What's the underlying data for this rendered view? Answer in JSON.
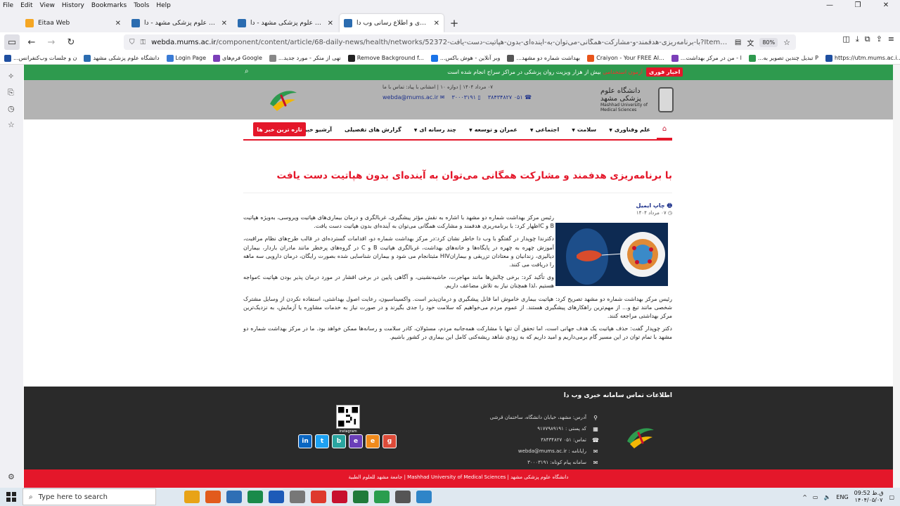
{
  "menubar": [
    "File",
    "Edit",
    "View",
    "History",
    "Bookmarks",
    "Tools",
    "Help"
  ],
  "window_controls": [
    "—",
    "❐",
    "✕"
  ],
  "tabs": [
    {
      "title": "Eitaa Web",
      "color": "#f5a623"
    },
    {
      "title": "دانشگاه علوم پزشکی مشهد - دا...",
      "color": "#2b6cb0"
    },
    {
      "title": "دانشگاه علوم پزشکی مشهد - دا...",
      "color": "#2b6cb0"
    },
    {
      "title": "پایگاه خبری و اطلاع رسانی وب دا",
      "color": "#2b6cb0"
    }
  ],
  "url": {
    "domain": "webda.mums.ac.ir",
    "prefix": "https://",
    "path": "/component/content/article/68-daily-news/health/networks/52372-با-برنامه‌ریزی-هدفمند-و-مشارکت-همگانی-می‌توان-به-آینده‌ای-بدون-هپاتیت-دست-یافت?Itemid=626"
  },
  "zoom": "80%",
  "bookmarks": [
    {
      "label": "...ن و جلسات وب‌کنفرانس",
      "color": "#1f4fa0"
    },
    {
      "label": "دانشگاه علوم پزشکی مشهد",
      "color": "#2b6cb0"
    },
    {
      "label": "Login Page",
      "color": "#3a7bd5"
    },
    {
      "label": "فرم‌های Google",
      "color": "#7b3fb8"
    },
    {
      "label": "...نهی از منکر - مورد جدید",
      "color": "#888888"
    },
    {
      "label": "Remove Background f...",
      "color": "#222222"
    },
    {
      "label": "...وبر آنلاین - هوش باکس",
      "color": "#1a73e8"
    },
    {
      "label": "...بهداشت شماره دو مشهد",
      "color": "#555555"
    },
    {
      "label": "Craiyon - Your FREE AI...",
      "color": "#e8541a"
    },
    {
      "label": "...ا - من در مرکز بهداشت",
      "color": "#7b3fb8"
    },
    {
      "label": "...تبدیل چندین تصویر به P",
      "color": "#2e9a4e"
    },
    {
      "label": "https://utm.mums.ac.i...",
      "color": "#1f4fa0"
    }
  ],
  "site": {
    "breaking_label": "اخبار فوری",
    "breaking_text_hl": "آزمون استخدامی",
    "breaking_text": " بیش از هزار ویزیت روان پزشکی در مراکز سراج انجام شده است",
    "university_fa": "دانشگاه علوم پزشکی مشهد",
    "university_en": "Mashhad University of Medical Sciences",
    "dates": "۰۷ مرداد ۱۴۰۴  |  دوازه ۱۰  |  امشانی با پیاد: تماس با ما",
    "phone1": "۰۵۱ ۳۸۴۳۴۸۲۷",
    "phone2": "۳۰۰۰۳۱۹۱",
    "email": "webda@mums.ac.ir",
    "nav_items": [
      "علم وفناوری",
      "سلامت",
      "اجتماعی",
      "عمران و توسعه",
      "چند رسانه ای",
      "گزارش های تفصیلی",
      "آرشیو خبری"
    ],
    "latest_button": "تازه ترین خبر ها"
  },
  "article": {
    "title": "با برنامه‌ریزی هدفمند و مشارکت همگانی می‌توان به آینده‌ای بدون هپاتیت دست یافت",
    "actions": "چاپ  ایمیل",
    "date": "۰۷ مرداد ۱۴۰۴",
    "paragraphs": [
      "رئیس مرکز بهداشت شماره دو مشهد با اشاره به نقش مؤثر  پیشگیری، غربالگری و درمان بیماری‌های هپاتیت ویروسی، به‌ویژه هپاتیت B و Cاظهار کرد: با برنامه‌ریزی هدفمند و مشارکت همگانی می‌توان به آینده‌ای بدون هپاتیت دست یافت.",
      "دکترندا چوپدار در گفتگو با وب دا خاطر نشان کرد:در مرکز بهداشت شماره دو، اقدامات گسترده‌ای در قالب طرح‌های نظام مراقبت، آموزش چهره به چهره در پایگاه‌ها و خانه‌های بهداشت، غربالگری هپاتیت B و C در گروه‌های پرخطر مانند مادران باردار، بیماران دیالیزی، زندانیان و معتادان تزریقی و بیمارانHIV مثبتانجام می شود و بیماران شناسایی شده بصورت رایگان، درمان دارویی سه ماهه را دریافت می کنند.",
      "وی تأکید کرد: برخی چالش‌ها مانند مهاجرت، حاشیه‌نشینی، و آگاهی پایین در برخی اقشار در مورد درمان پذیر بودن هپاتیت cمواجه هستیم ،لذا همچنان نیاز به تلاش مضاعف داریم.",
      "رئیس مرکز بهداشت شماره دو مشهد  تصریح کرد: هپاتیت بیماری خاموش اما قابل پیشگیری و درمان‌پذیر است. واکسیناسیون، رعایت اصول بهداشتی، استفاده نکردن از وسایل مشترک شخصی مانند تیغ و... از مهم‌ترین راهکارهای پیشگیری هستند. از عموم مردم می‌خواهیم که سلامت خود را جدی بگیرند و در صورت نیاز به خدمات مشاوره یا آزمایش، به نزدیک‌ترین مرکز بهداشتی مراجعه کنند.",
      "دکتر چوپدار گفت: حذف هپاتیت یک هدف جهانی است، اما تحقق آن تنها با مشارکت همه‌جانبه مردم، مسئولان، کادر سلامت و رسانه‌ها ممکن خواهد بود. ما در مرکز بهداشت شماره دو مشهد با تمام توان در این مسیر گام برمی‌داریم و امید داریم که به زودی شاهد ریشه‌کنی کامل این بیماری در کشور باشیم."
    ]
  },
  "footer": {
    "title": "اطلاعات تماس سامانه خبری وب دا",
    "contacts": [
      {
        "icon": "location-icon",
        "text": "آدرس: مشهد، خیابان دانشگاه، ساختمان قرشی"
      },
      {
        "icon": "postal-icon",
        "text": "کد پستی : ۹۱۷۷۹۸۹۱۹۱"
      },
      {
        "icon": "phone-icon",
        "text": "تماس: ۰۵۱ ۳۸۴۳۴۸۲۷"
      },
      {
        "icon": "email-icon",
        "text": "رایانامه : webda@mums.ac.ir"
      },
      {
        "icon": "sms-icon",
        "text": "سامانه پیام کوتاه: ۳۰۰۰۳۱۹۱"
      }
    ],
    "qr_caption": "instagram",
    "socials": [
      {
        "name": "linkedin-icon",
        "glyph": "in",
        "color": "#0a66c2"
      },
      {
        "name": "twitter-icon",
        "glyph": "t",
        "color": "#1da1f2"
      },
      {
        "name": "bale-icon",
        "glyph": "b",
        "color": "#2aa5a0"
      },
      {
        "name": "eitaa-icon",
        "glyph": "e",
        "color": "#6a3fb8"
      },
      {
        "name": "eitaa-alt-icon",
        "glyph": "e",
        "color": "#f08a1c"
      },
      {
        "name": "gplus-icon",
        "glyph": "g",
        "color": "#dd4b39"
      }
    ],
    "copyright": "دانشگاه علوم پزشکی مشهد | Mashhad University of Medical Sciences | جامعة مشهد للعلوم الطبية"
  },
  "taskbar": {
    "search_placeholder": "Type here to search",
    "lang": "ENG",
    "time": "09:52 ق.ظ",
    "date": "۱۴۰۴/۰۵/۰۷",
    "apps": [
      "#e8a317",
      "#e25b1c",
      "#2f6fb5",
      "#1a8a4a",
      "#1d5bb8",
      "#777777",
      "#de3a2d",
      "#c8102e",
      "#1f7a3a",
      "#2a9d4e",
      "#555555",
      "#2f85c8"
    ]
  },
  "colors": {
    "accent_red": "#e4172a",
    "green_strip": "#2e9a4e",
    "header_gray": "#b3b3b3",
    "footer_dark": "#2a2a2a",
    "link_blue": "#1b2f8a"
  }
}
